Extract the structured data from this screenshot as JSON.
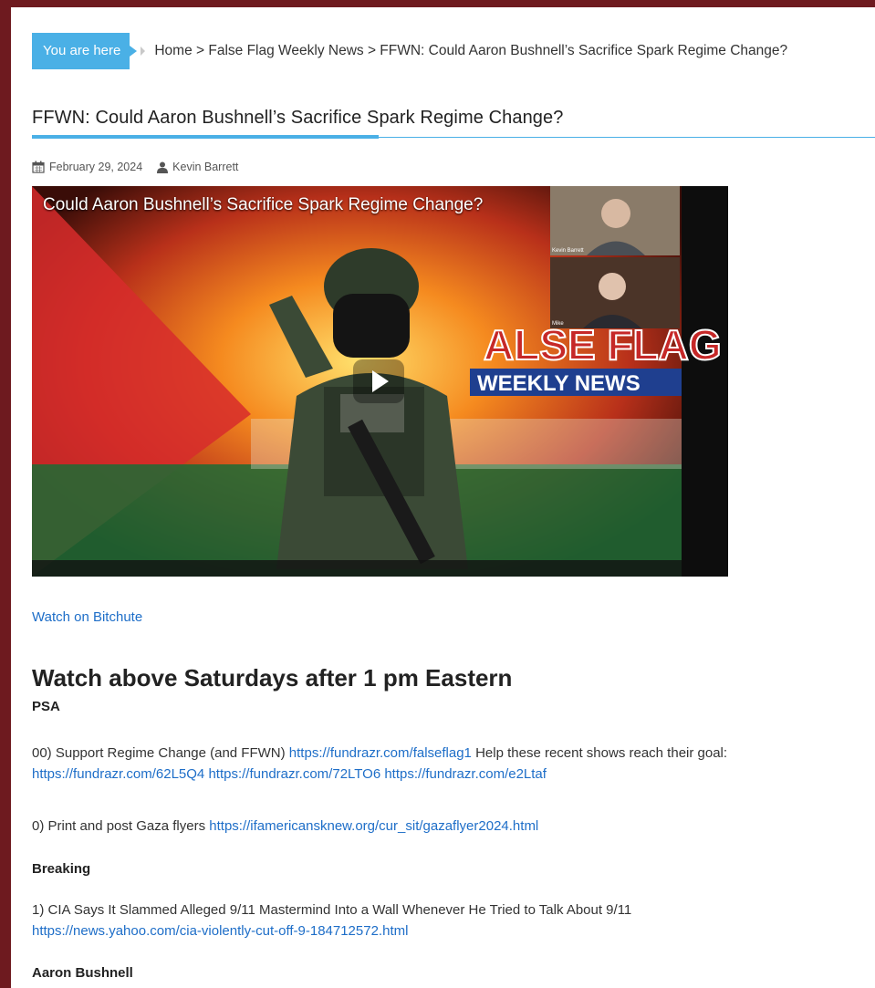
{
  "breadcrumb": {
    "you_are_here": "You are here",
    "path": "Home > False Flag Weekly News > FFWN: Could Aaron Bushnell’s Sacrifice Spark Regime Change?"
  },
  "post": {
    "title": "FFWN: Could Aaron Bushnell’s Sacrifice Spark Regime Change?",
    "date": "February 29, 2024",
    "author": "Kevin Barrett"
  },
  "video": {
    "title": "Could Aaron Bushnell’s Sacrifice Spark Regime Change?",
    "logo_line1": "ALSE FLAG",
    "logo_line2": "WEEKLY NEWS",
    "inset1_label": "Kevin Barrett",
    "inset2_label": "Mike"
  },
  "watch_link": "Watch on Bitchute",
  "heading": "Watch above Saturdays after 1 pm Eastern",
  "sections": {
    "psa": "PSA",
    "breaking": "Breaking",
    "aaron": "Aaron Bushnell"
  },
  "items": {
    "i00_text": "00) Support Regime Change (and FFWN) ",
    "i00_link1": "https://fundrazr.com/falseflag1",
    "i00_text2": " Help these recent shows reach their goal: ",
    "i00_link2": "https://fundrazr.com/62L5Q4",
    "i00_link3": "https://fundrazr.com/72LTO6",
    "i00_link4": "https://fundrazr.com/e2Ltaf",
    "i0_text": "0) Print and post Gaza flyers ",
    "i0_link": "https://ifamericansknew.org/cur_sit/gazaflyer2024.html",
    "i1_text": "1) CIA Says It Slammed Alleged 9/11 Mastermind Into a Wall Whenever He Tried to Talk About 9/11",
    "i1_link": "https://news.yahoo.com/cia-violently-cut-off-9-184712572.html"
  },
  "colors": {
    "frame": "#6e1a1f",
    "accent": "#4ab0e6",
    "link": "#1e6ec8"
  }
}
